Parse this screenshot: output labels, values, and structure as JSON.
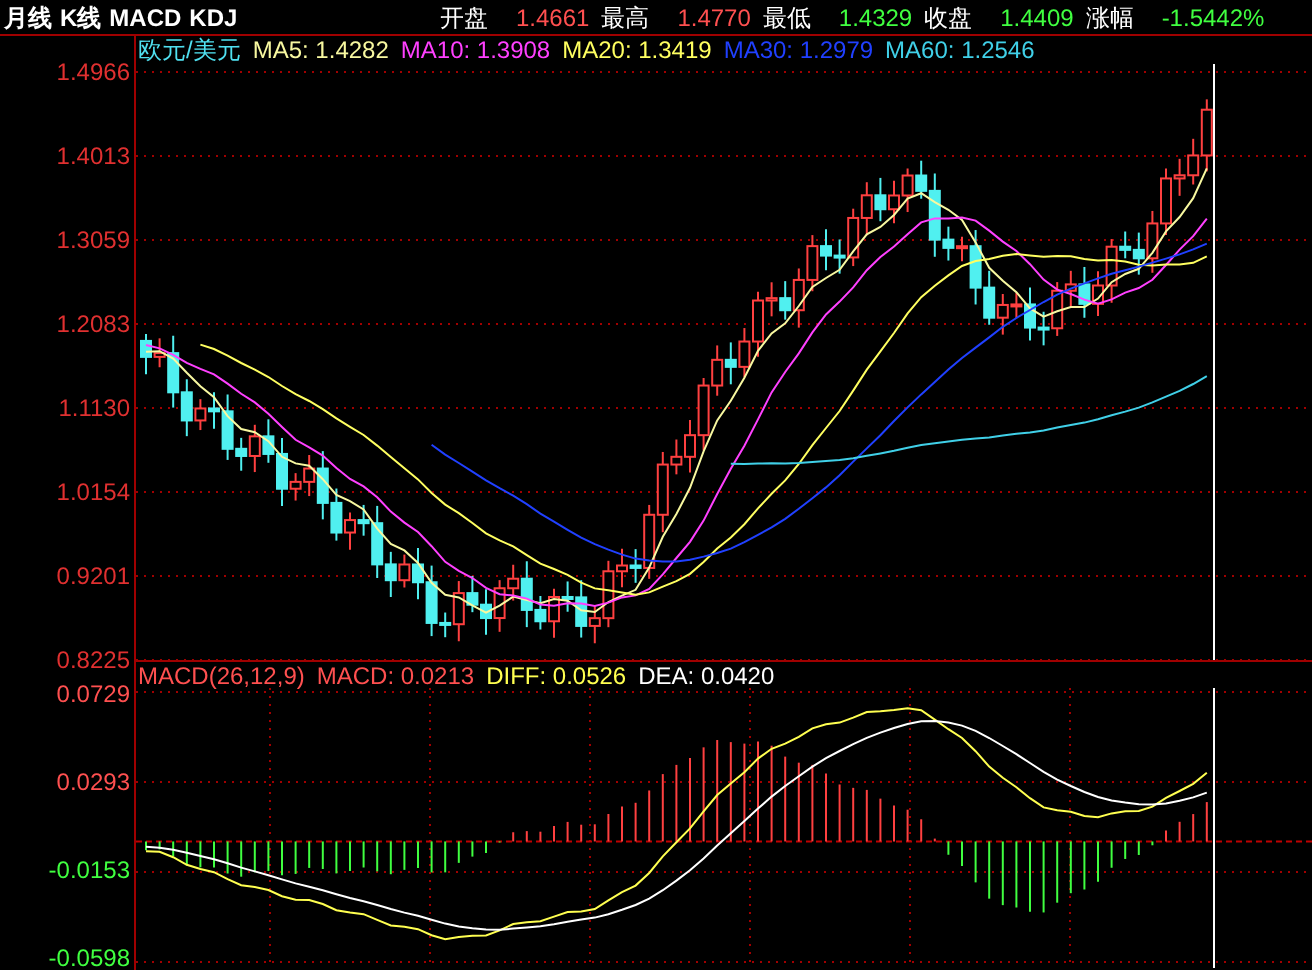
{
  "title_bar": {
    "menu": [
      "月线",
      "K线",
      "MACD",
      "KDJ"
    ],
    "quote": [
      {
        "label": "开盘",
        "value": "1.4661",
        "color": "#ff5050"
      },
      {
        "label": "最高",
        "value": "1.4770",
        "color": "#ff5050"
      },
      {
        "label": "最低",
        "value": "1.4329",
        "color": "#40ff40"
      },
      {
        "label": "收盘",
        "value": "1.4409",
        "color": "#40ff40"
      },
      {
        "label": "涨幅",
        "value": "-1.5442%",
        "color": "#40ff40"
      }
    ]
  },
  "price_chart": {
    "symbol": "欧元/美元",
    "moving_averages": [
      {
        "text": "MA5: 1.4282",
        "color": "#f8f8a0"
      },
      {
        "text": "MA10: 1.3908",
        "color": "#ff40ff"
      },
      {
        "text": "MA20: 1.3419",
        "color": "#ffff60"
      },
      {
        "text": "MA30: 1.2979",
        "color": "#2040ff"
      },
      {
        "text": "MA60: 1.2546",
        "color": "#40d0e8"
      }
    ],
    "y_axis": [
      "1.4966",
      "1.4013",
      "1.3059",
      "1.2083",
      "1.1130",
      "1.0154",
      "0.9201",
      "0.8225"
    ]
  },
  "macd_chart": {
    "legend": [
      {
        "text": "MACD(26,12,9)",
        "color": "#ff5050"
      },
      {
        "text": "MACD: 0.0213",
        "color": "#ff5050"
      },
      {
        "text": "DIFF: 0.0526",
        "color": "#ffff50"
      },
      {
        "text": "DEA: 0.0420",
        "color": "#ffffff"
      }
    ],
    "y_axis": [
      {
        "label": "0.0729",
        "color": "#ff5050"
      },
      {
        "label": "0.0293",
        "color": "#ff5050"
      },
      {
        "label": "-0.0153",
        "color": "#40ff40"
      },
      {
        "label": "-0.0598",
        "color": "#40ff40"
      }
    ]
  }
}
